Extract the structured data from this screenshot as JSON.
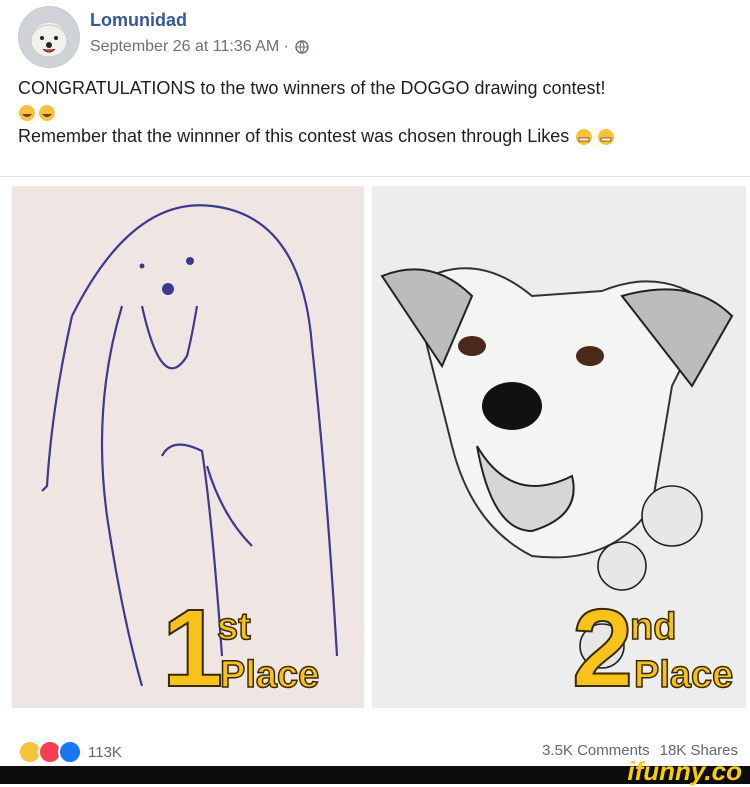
{
  "post": {
    "author": "Lomunidad",
    "timestamp": "September 26 at 11:36 AM ·",
    "line1": "CONGRATULATIONS to the two winners of the DOGGO drawing contest!",
    "line3": "Remember that the winnner of this contest was chosen through Likes"
  },
  "images": {
    "left": {
      "num": "1",
      "sup": "st",
      "word": "Place"
    },
    "right": {
      "num": "2",
      "sup": "nd",
      "word": "Place"
    }
  },
  "footer": {
    "reaction_count": "113K",
    "comments": "3.5K Comments",
    "shares": "18K Shares"
  },
  "watermark": {
    "text": "ifunny.co"
  },
  "icons": [
    "globe-icon",
    "laugh-emoji-icon",
    "heart-reaction-icon",
    "like-reaction-icon"
  ],
  "colors": {
    "author": "#365899",
    "place_gold": "#f7c21a",
    "watermark_bg": "#0d0d0d",
    "watermark_fg": "#ffcc00"
  }
}
